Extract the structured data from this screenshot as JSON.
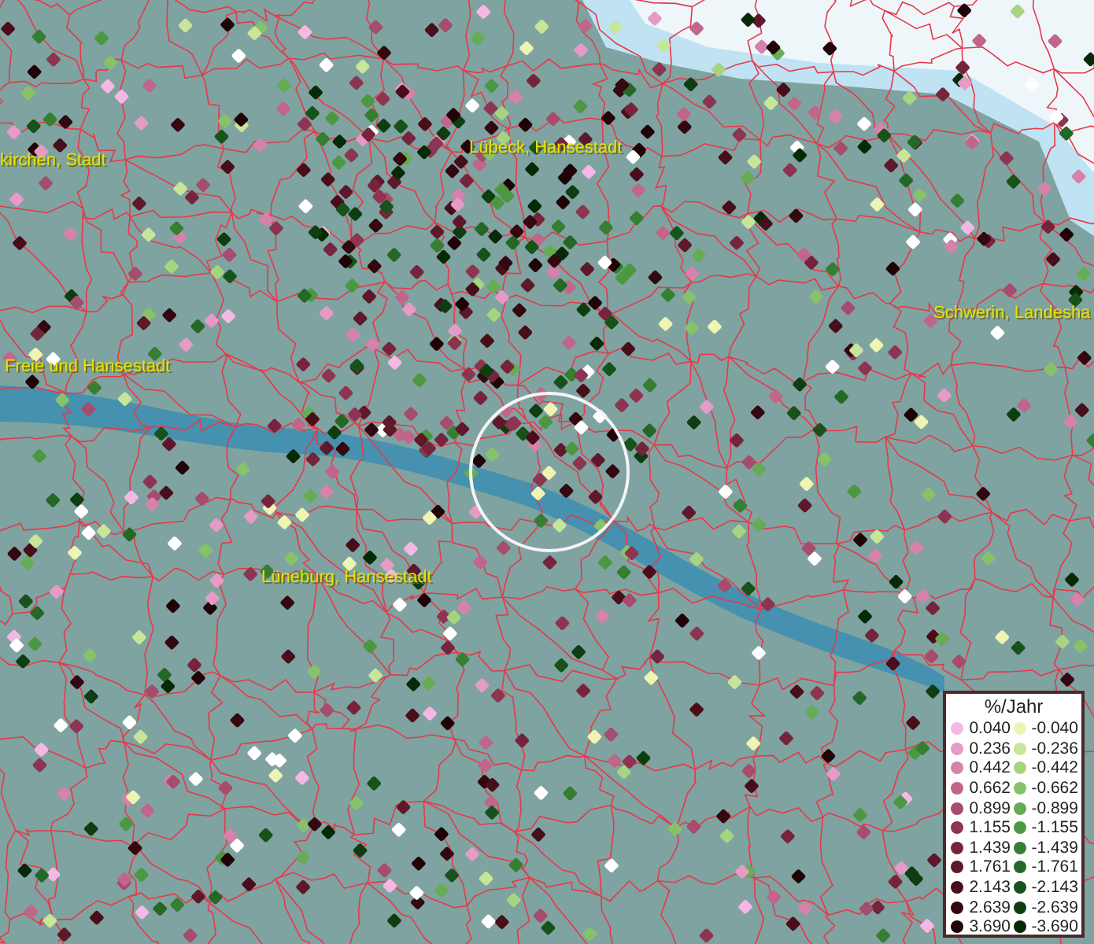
{
  "map": {
    "labels": [
      {
        "text": "kirchen, Stadt"
      },
      {
        "text": "Lübeck, Hansestadt"
      },
      {
        "text": "Schwerin, Landesha"
      },
      {
        "text": "Freie und Hansestadt"
      },
      {
        "text": "Lüneburg, Hansestadt"
      }
    ]
  },
  "legend": {
    "title": "%/Jahr",
    "columns": [
      {
        "entries": [
          {
            "value": "0.040",
            "color": "#f5b8e4"
          },
          {
            "value": "0.236",
            "color": "#e69ac6"
          },
          {
            "value": "0.442",
            "color": "#d682aa"
          },
          {
            "value": "0.662",
            "color": "#c0668a"
          },
          {
            "value": "0.899",
            "color": "#a64c6c"
          },
          {
            "value": "1.155",
            "color": "#8c3450"
          },
          {
            "value": "1.439",
            "color": "#76243c"
          },
          {
            "value": "1.761",
            "color": "#5e182a"
          },
          {
            "value": "2.143",
            "color": "#480e1a"
          },
          {
            "value": "2.639",
            "color": "#340810"
          },
          {
            "value": "3.690",
            "color": "#200306"
          }
        ]
      },
      {
        "entries": [
          {
            "value": "-0.040",
            "color": "#eef5b2"
          },
          {
            "value": "-0.236",
            "color": "#c8e69a"
          },
          {
            "value": "-0.442",
            "color": "#a6d480"
          },
          {
            "value": "-0.662",
            "color": "#86c26a"
          },
          {
            "value": "-0.899",
            "color": "#66ac54"
          },
          {
            "value": "-1.155",
            "color": "#4c9842"
          },
          {
            "value": "-1.439",
            "color": "#357e32"
          },
          {
            "value": "-1.761",
            "color": "#236826"
          },
          {
            "value": "-2.143",
            "color": "#16521a"
          },
          {
            "value": "-2.639",
            "color": "#0d3d10"
          },
          {
            "value": "-3.690",
            "color": "#062a07"
          }
        ]
      }
    ]
  }
}
